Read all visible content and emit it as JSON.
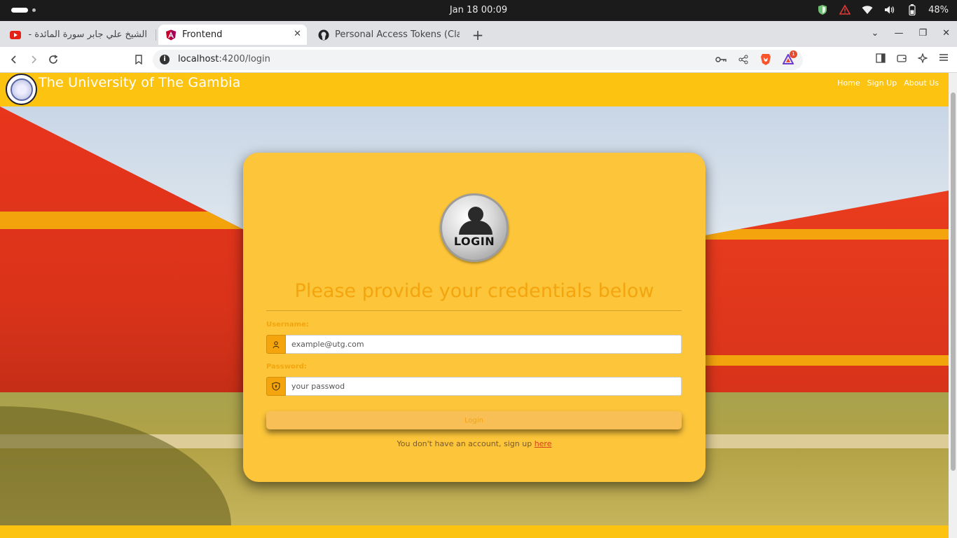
{
  "os": {
    "clock": "Jan 18  00:09",
    "battery": "48%"
  },
  "browser": {
    "tabs": [
      {
        "title": "الشيخ علي جابر سورة المائدة - e",
        "favicon": "youtube-icon"
      },
      {
        "title": "Frontend",
        "favicon": "angular-icon"
      },
      {
        "title": "Personal Access Tokens (Cla",
        "favicon": "github-icon"
      }
    ],
    "url_host": "localhost",
    "url_path": ":4200/login",
    "notification_count": "1"
  },
  "site": {
    "title": "The University of The Gambia",
    "nav": [
      "Home",
      "Sign Up",
      "About Us"
    ]
  },
  "login": {
    "icon_text": "LOGIN",
    "heading": "Please provide your credentials below",
    "username_label": "Username:",
    "username_placeholder": "example@utg.com",
    "password_label": "Password:",
    "password_placeholder": "your passwod",
    "button_label": "Login",
    "signup_prompt": "You don't have an account, sign up ",
    "signup_link": "here"
  },
  "colors": {
    "brand_yellow": "#fdc311",
    "card_bg": "#fcc53a",
    "accent_orange": "#f4a50e"
  }
}
